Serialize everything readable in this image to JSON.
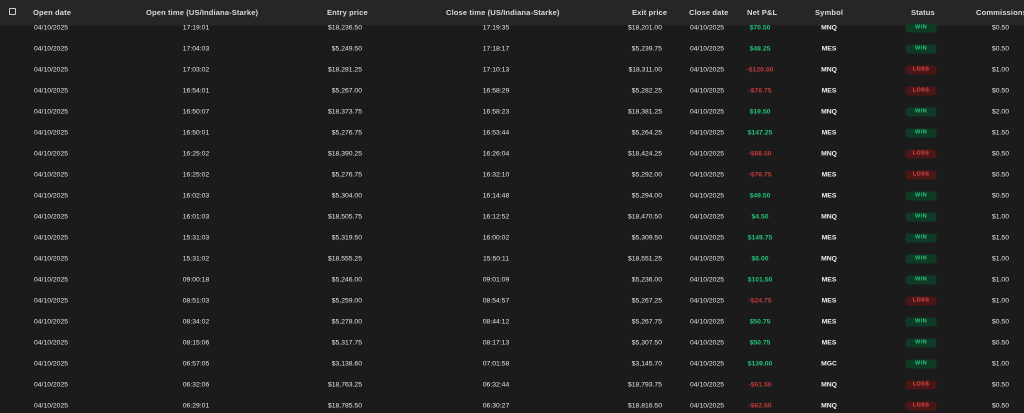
{
  "columns": {
    "open_date": "Open date",
    "open_time": "Open time (US/Indiana-Starke)",
    "entry_price": "Entry price",
    "close_time": "Close time (US/Indiana-Starke)",
    "exit_price": "Exit price",
    "close_date": "Close date",
    "net_pnl": "Net P&L",
    "symbol": "Symbol",
    "status": "Status",
    "commissions": "Commissions"
  },
  "colors": {
    "win": "#21c27a",
    "loss": "#c23a3a",
    "background": "#1b1b1b",
    "header": "#262626"
  },
  "rows": [
    {
      "open_date": "04/10/2025",
      "open_time": "17:19:01",
      "entry_price": "$18,236.50",
      "close_time": "17:19:35",
      "exit_price": "$18,201.00",
      "close_date": "04/10/2025",
      "net_pnl": "$70.50",
      "symbol": "MNQ",
      "status": "WIN",
      "commissions": "$0.50"
    },
    {
      "open_date": "04/10/2025",
      "open_time": "17:04:03",
      "entry_price": "$5,249.50",
      "close_time": "17:18:17",
      "exit_price": "$5,239.75",
      "close_date": "04/10/2025",
      "net_pnl": "$48.25",
      "symbol": "MES",
      "status": "WIN",
      "commissions": "$0.50"
    },
    {
      "open_date": "04/10/2025",
      "open_time": "17:03:02",
      "entry_price": "$18,281.25",
      "close_time": "17:10:13",
      "exit_price": "$18,311.00",
      "close_date": "04/10/2025",
      "net_pnl": "-$120.00",
      "symbol": "MNQ",
      "status": "LOSS",
      "commissions": "$1.00"
    },
    {
      "open_date": "04/10/2025",
      "open_time": "16:54:01",
      "entry_price": "$5,267.00",
      "close_time": "16:58:29",
      "exit_price": "$5,282.25",
      "close_date": "04/10/2025",
      "net_pnl": "-$76.75",
      "symbol": "MES",
      "status": "LOSS",
      "commissions": "$0.50"
    },
    {
      "open_date": "04/10/2025",
      "open_time": "16:50:07",
      "entry_price": "$18,373.75",
      "close_time": "16:58:23",
      "exit_price": "$18,381.25",
      "close_date": "04/10/2025",
      "net_pnl": "$19.50",
      "symbol": "MNQ",
      "status": "WIN",
      "commissions": "$2.00"
    },
    {
      "open_date": "04/10/2025",
      "open_time": "16:50:01",
      "entry_price": "$5,276.75",
      "close_time": "16:53:44",
      "exit_price": "$5,264.25",
      "close_date": "04/10/2025",
      "net_pnl": "$147.25",
      "symbol": "MES",
      "status": "WIN",
      "commissions": "$1.50"
    },
    {
      "open_date": "04/10/2025",
      "open_time": "16:25:02",
      "entry_price": "$18,390.25",
      "close_time": "16:26:04",
      "exit_price": "$18,424.25",
      "close_date": "04/10/2025",
      "net_pnl": "-$68.50",
      "symbol": "MNQ",
      "status": "LOSS",
      "commissions": "$0.50"
    },
    {
      "open_date": "04/10/2025",
      "open_time": "16:25:02",
      "entry_price": "$5,276.75",
      "close_time": "16:32:10",
      "exit_price": "$5,292.00",
      "close_date": "04/10/2025",
      "net_pnl": "-$76.75",
      "symbol": "MES",
      "status": "LOSS",
      "commissions": "$0.50"
    },
    {
      "open_date": "04/10/2025",
      "open_time": "16:02:03",
      "entry_price": "$5,304.00",
      "close_time": "16:14:48",
      "exit_price": "$5,294.00",
      "close_date": "04/10/2025",
      "net_pnl": "$49.50",
      "symbol": "MES",
      "status": "WIN",
      "commissions": "$0.50"
    },
    {
      "open_date": "04/10/2025",
      "open_time": "16:01:03",
      "entry_price": "$18,505.75",
      "close_time": "16:12:52",
      "exit_price": "$18,470.50",
      "close_date": "04/10/2025",
      "net_pnl": "$4.50",
      "symbol": "MNQ",
      "status": "WIN",
      "commissions": "$1.00"
    },
    {
      "open_date": "04/10/2025",
      "open_time": "15:31:03",
      "entry_price": "$5,319.50",
      "close_time": "16:00:02",
      "exit_price": "$5,309.50",
      "close_date": "04/10/2025",
      "net_pnl": "$149.75",
      "symbol": "MES",
      "status": "WIN",
      "commissions": "$1.50"
    },
    {
      "open_date": "04/10/2025",
      "open_time": "15:31:02",
      "entry_price": "$18,555.25",
      "close_time": "15:50:11",
      "exit_price": "$18,551.25",
      "close_date": "04/10/2025",
      "net_pnl": "$6.00",
      "symbol": "MNQ",
      "status": "WIN",
      "commissions": "$1.00"
    },
    {
      "open_date": "04/10/2025",
      "open_time": "09:00:18",
      "entry_price": "$5,246.00",
      "close_time": "09:01:09",
      "exit_price": "$5,236.00",
      "close_date": "04/10/2025",
      "net_pnl": "$101.50",
      "symbol": "MES",
      "status": "WIN",
      "commissions": "$1.00"
    },
    {
      "open_date": "04/10/2025",
      "open_time": "08:51:03",
      "entry_price": "$5,259.00",
      "close_time": "08:54:57",
      "exit_price": "$5,267.25",
      "close_date": "04/10/2025",
      "net_pnl": "-$24.75",
      "symbol": "MES",
      "status": "LOSS",
      "commissions": "$1.00"
    },
    {
      "open_date": "04/10/2025",
      "open_time": "08:34:02",
      "entry_price": "$5,278.00",
      "close_time": "08:44:12",
      "exit_price": "$5,267.75",
      "close_date": "04/10/2025",
      "net_pnl": "$50.75",
      "symbol": "MES",
      "status": "WIN",
      "commissions": "$0.50"
    },
    {
      "open_date": "04/10/2025",
      "open_time": "08:15:06",
      "entry_price": "$5,317.75",
      "close_time": "08:17:13",
      "exit_price": "$5,307.50",
      "close_date": "04/10/2025",
      "net_pnl": "$50.75",
      "symbol": "MES",
      "status": "WIN",
      "commissions": "$0.50"
    },
    {
      "open_date": "04/10/2025",
      "open_time": "06:57:05",
      "entry_price": "$3,138.60",
      "close_time": "07:01:58",
      "exit_price": "$3,145.70",
      "close_date": "04/10/2025",
      "net_pnl": "$139.00",
      "symbol": "MGC",
      "status": "WIN",
      "commissions": "$1.00"
    },
    {
      "open_date": "04/10/2025",
      "open_time": "06:32:06",
      "entry_price": "$18,763.25",
      "close_time": "06:32:44",
      "exit_price": "$18,793.75",
      "close_date": "04/10/2025",
      "net_pnl": "-$61.50",
      "symbol": "MNQ",
      "status": "LOSS",
      "commissions": "$0.50"
    },
    {
      "open_date": "04/10/2025",
      "open_time": "06:29:01",
      "entry_price": "$18,785.50",
      "close_time": "06:30:27",
      "exit_price": "$18,816.50",
      "close_date": "04/10/2025",
      "net_pnl": "-$62.50",
      "symbol": "MNQ",
      "status": "LOSS",
      "commissions": "$0.50"
    }
  ]
}
